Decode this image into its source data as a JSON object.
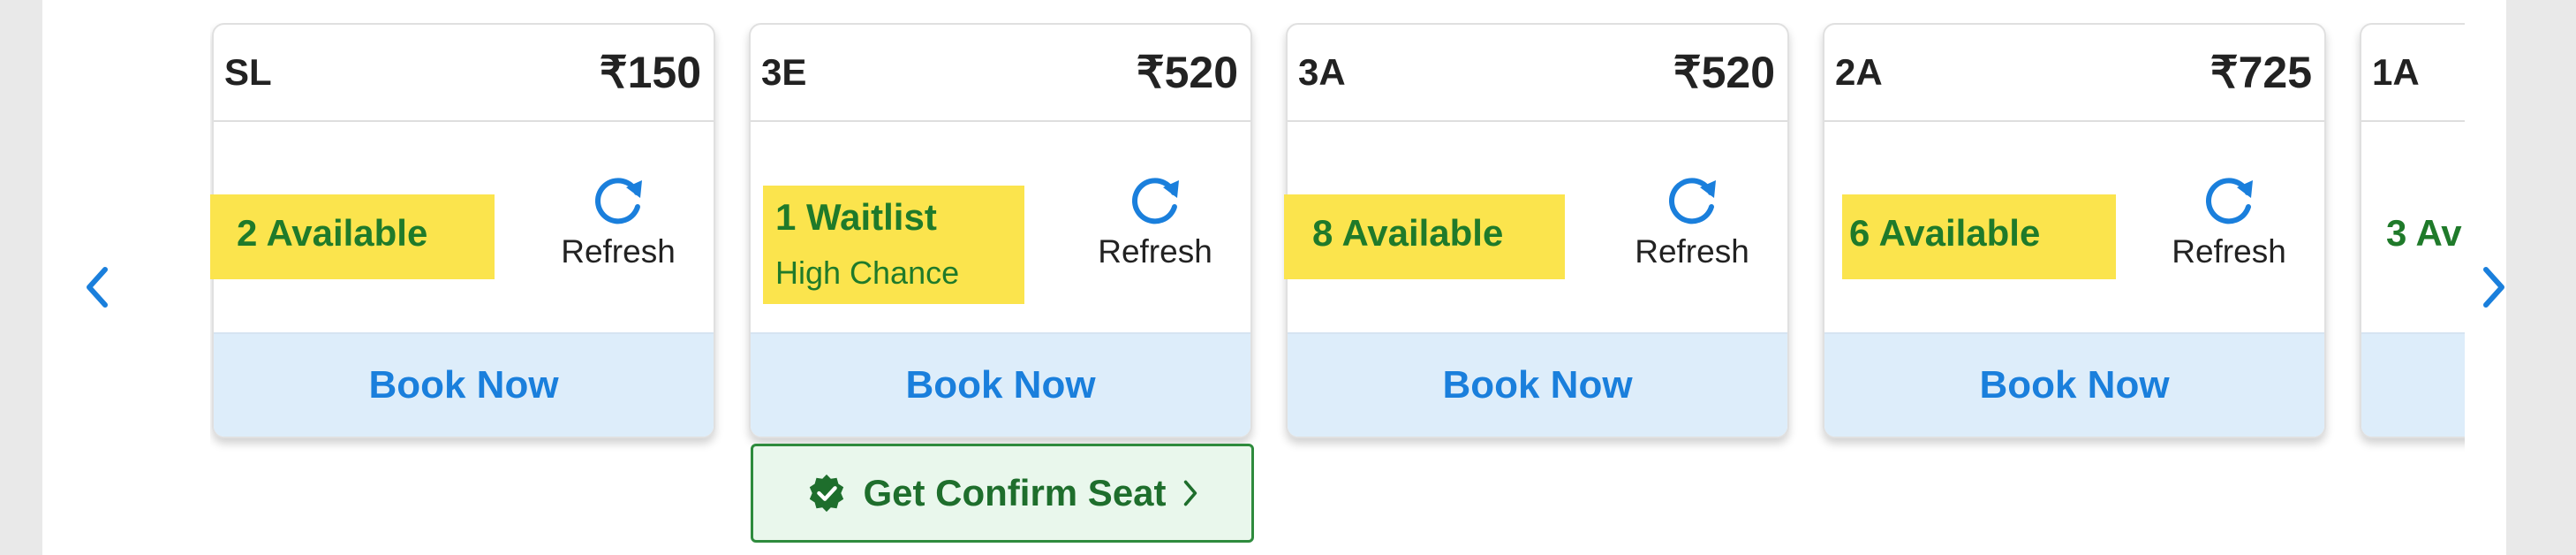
{
  "carousel": {
    "cards": [
      {
        "class_code": "SL",
        "fare": "₹150",
        "status": "2 Available",
        "refresh_label": "Refresh",
        "book_label": "Book Now"
      },
      {
        "class_code": "3E",
        "fare": "₹520",
        "status": "1 Waitlist",
        "sub_status": "High Chance",
        "refresh_label": "Refresh",
        "book_label": "Book Now"
      },
      {
        "class_code": "3A",
        "fare": "₹520",
        "status": "8 Available",
        "refresh_label": "Refresh",
        "book_label": "Book Now"
      },
      {
        "class_code": "2A",
        "fare": "₹725",
        "status": "6 Available",
        "refresh_label": "Refresh",
        "book_label": "Book Now"
      },
      {
        "class_code": "1A",
        "status": "3 Av"
      }
    ]
  },
  "confirm_seat": {
    "label": "Get Confirm Seat"
  },
  "icons": {
    "prev": "chevron-left-icon",
    "next": "chevron-right-icon",
    "refresh": "refresh-icon",
    "verified": "verified-badge-icon",
    "arrow": "chevron-right-icon"
  },
  "colors": {
    "highlight": "#fbe44d",
    "available_green": "#1f7a2a",
    "book_blue": "#1a7fdc",
    "book_bg": "#ddedfa",
    "confirm_border": "#2e8b3d",
    "confirm_bg": "#e9f7ec"
  }
}
